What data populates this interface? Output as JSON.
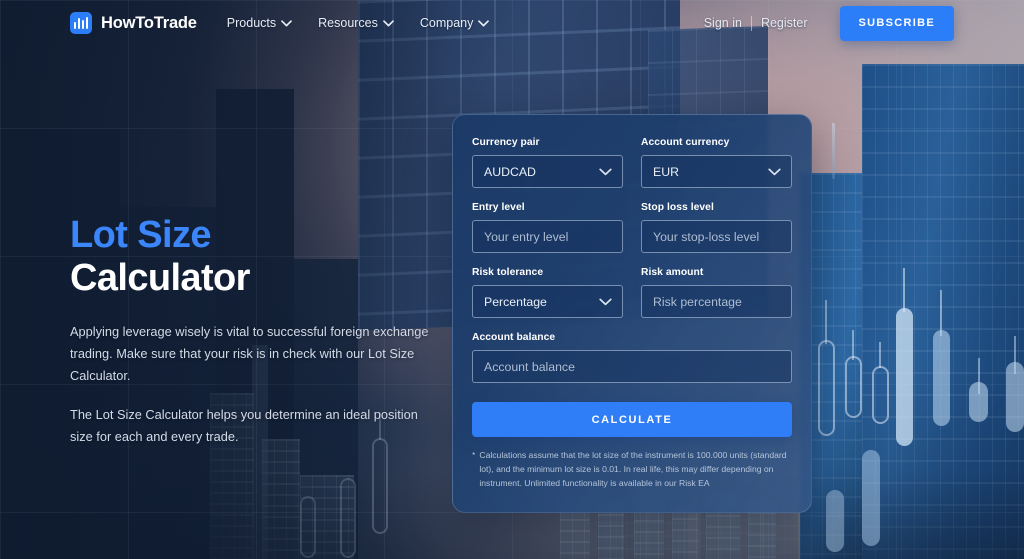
{
  "brand": {
    "name": "HowToTrade",
    "logo_icon": "bar-chart-logo-icon",
    "accent_color": "#2c7ef8"
  },
  "header": {
    "nav": [
      {
        "label": "Products",
        "icon": "chevron-down-icon"
      },
      {
        "label": "Resources",
        "icon": "chevron-down-icon"
      },
      {
        "label": "Company",
        "icon": "chevron-down-icon"
      }
    ],
    "sign_in": "Sign in",
    "register": "Register",
    "subscribe": "SUBSCRIBE"
  },
  "hero": {
    "title_line1": "Lot Size",
    "title_line2": "Calculator",
    "title_line1_color": "#3b86fb",
    "paragraph1": "Applying leverage wisely is vital to successful foreign exchange trading. Make sure that your risk is in check with our Lot Size Calculator.",
    "paragraph2": "The Lot Size Calculator helps you determine an ideal position size for each and every trade."
  },
  "calculator": {
    "fields": {
      "currency_pair": {
        "label": "Currency pair",
        "type": "select",
        "value": "AUDCAD",
        "icon": "chevron-down-icon"
      },
      "account_currency": {
        "label": "Account currency",
        "type": "select",
        "value": "EUR",
        "icon": "chevron-down-icon"
      },
      "entry_level": {
        "label": "Entry level",
        "type": "input",
        "value": "",
        "placeholder": "Your entry level"
      },
      "stop_loss_level": {
        "label": "Stop loss level",
        "type": "input",
        "value": "",
        "placeholder": "Your stop-loss level"
      },
      "risk_tolerance": {
        "label": "Risk tolerance",
        "type": "select",
        "value": "Percentage",
        "icon": "chevron-down-icon"
      },
      "risk_amount": {
        "label": "Risk amount",
        "type": "input",
        "value": "",
        "placeholder": "Risk percentage"
      },
      "account_balance": {
        "label": "Account balance",
        "type": "input",
        "value": "",
        "placeholder": "Account balance"
      }
    },
    "submit_label": "CALCULATE",
    "disclaimer_marker": "*",
    "disclaimer": "Calculations assume that the lot size of the instrument is 100.000 units (standard lot), and the minimum lot size is 0.01. In real life, this may differ depending on instrument. Unlimited functionality is available in our Risk EA",
    "button_color": "#2f7ef7"
  }
}
